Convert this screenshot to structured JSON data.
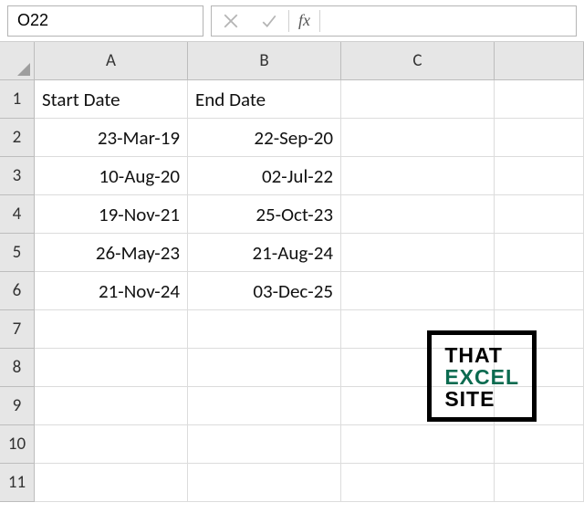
{
  "app": "Excel",
  "formula_bar": {
    "name_box_value": "O22",
    "formula_value": "",
    "fx_label": "fx"
  },
  "columns": [
    "A",
    "B",
    "C",
    ""
  ],
  "rows": [
    "1",
    "2",
    "3",
    "4",
    "5",
    "6",
    "7",
    "8",
    "9",
    "10",
    "11"
  ],
  "headers": {
    "A": "Start Date",
    "B": "End Date"
  },
  "data": {
    "A": [
      "23-Mar-19",
      "10-Aug-20",
      "19-Nov-21",
      "26-May-23",
      "21-Nov-24"
    ],
    "B": [
      "22-Sep-20",
      "02-Jul-22",
      "25-Oct-23",
      "21-Aug-24",
      "03-Dec-25"
    ]
  },
  "watermark": {
    "line1": "THAT",
    "line2": "EXCEL",
    "line3": "SITE"
  },
  "chart_data": {
    "type": "table",
    "title": "",
    "columns": [
      "Start Date",
      "End Date"
    ],
    "rows": [
      [
        "23-Mar-19",
        "22-Sep-20"
      ],
      [
        "10-Aug-20",
        "02-Jul-22"
      ],
      [
        "19-Nov-21",
        "25-Oct-23"
      ],
      [
        "26-May-23",
        "21-Aug-24"
      ],
      [
        "21-Nov-24",
        "03-Dec-25"
      ]
    ]
  }
}
